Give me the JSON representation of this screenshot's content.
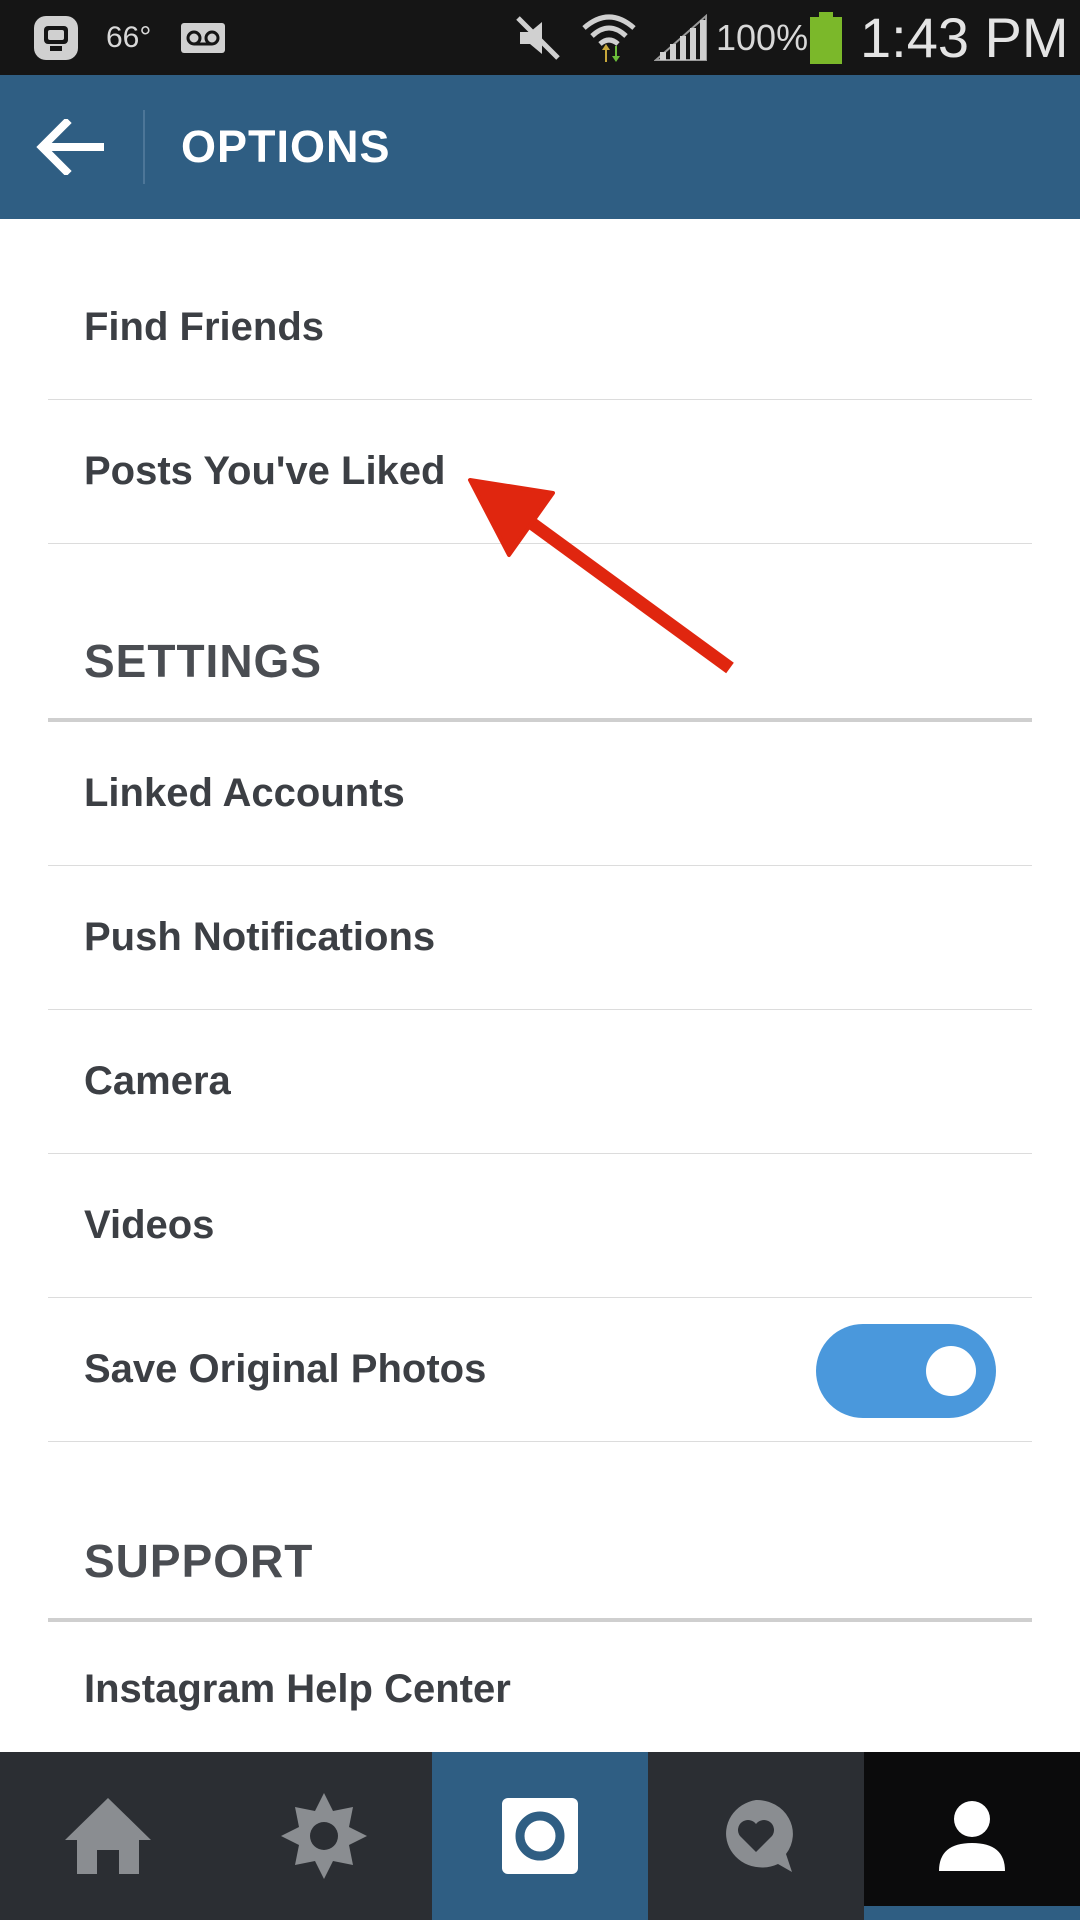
{
  "status_bar": {
    "temperature": "66°",
    "battery_percent": "100%",
    "time": "1:43 PM",
    "icons": [
      "app-notification-icon",
      "voicemail-icon",
      "mute-icon",
      "wifi-icon",
      "signal-icon",
      "battery-icon"
    ]
  },
  "action_bar": {
    "title": "OPTIONS",
    "back_icon": "arrow-left-icon"
  },
  "options": {
    "find_friends": "Find Friends",
    "posts_liked": "Posts You've Liked"
  },
  "settings": {
    "header": "SETTINGS",
    "items": [
      "Linked Accounts",
      "Push Notifications",
      "Camera",
      "Videos"
    ],
    "save_original_photos": {
      "label": "Save Original Photos",
      "enabled": true
    }
  },
  "support": {
    "header": "SUPPORT",
    "help_center": "Instagram Help Center"
  },
  "bottom_nav": {
    "tabs": [
      "home-icon",
      "explore-icon",
      "camera-icon",
      "activity-icon",
      "profile-icon"
    ],
    "active": "profile-icon"
  },
  "colors": {
    "action_bar": "#2f5e83",
    "toggle_on": "#4a98dc",
    "annotation_arrow": "#e0260f",
    "text": "#3c3f44"
  }
}
